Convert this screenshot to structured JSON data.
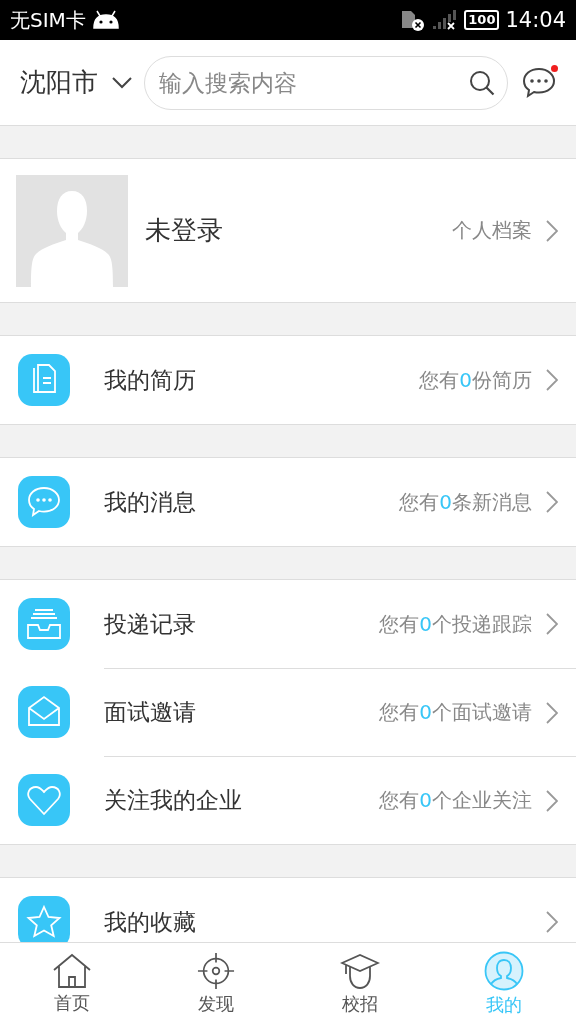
{
  "status_bar": {
    "carrier": "无SIM卡",
    "battery": "100",
    "time": "14:04"
  },
  "header": {
    "city": "沈阳市",
    "search": {
      "placeholder": "输入搜索内容"
    },
    "messages_unread": true
  },
  "profile": {
    "name": "未登录",
    "link": "个人档案"
  },
  "sections": [
    {
      "items": [
        {
          "label": "我的简历",
          "summary": {
            "before": "您有",
            "count": "0",
            "after": "份简历"
          }
        }
      ]
    },
    {
      "items": [
        {
          "label": "我的消息",
          "summary": {
            "before": "您有",
            "count": "0",
            "after": "条新消息"
          }
        }
      ]
    },
    {
      "items": [
        {
          "label": "投递记录",
          "summary": {
            "before": "您有",
            "count": "0",
            "after": "个投递跟踪"
          }
        },
        {
          "label": "面试邀请",
          "summary": {
            "before": "您有",
            "count": "0",
            "after": "个面试邀请"
          }
        },
        {
          "label": "关注我的企业",
          "summary": {
            "before": "您有",
            "count": "0",
            "after": "个企业关注"
          }
        }
      ]
    },
    {
      "items": [
        {
          "label": "我的收藏"
        }
      ]
    }
  ],
  "tabs": [
    {
      "label": "首页",
      "selected": false
    },
    {
      "label": "发现",
      "selected": false
    },
    {
      "label": "校招",
      "selected": false
    },
    {
      "label": "我的",
      "selected": true
    }
  ]
}
